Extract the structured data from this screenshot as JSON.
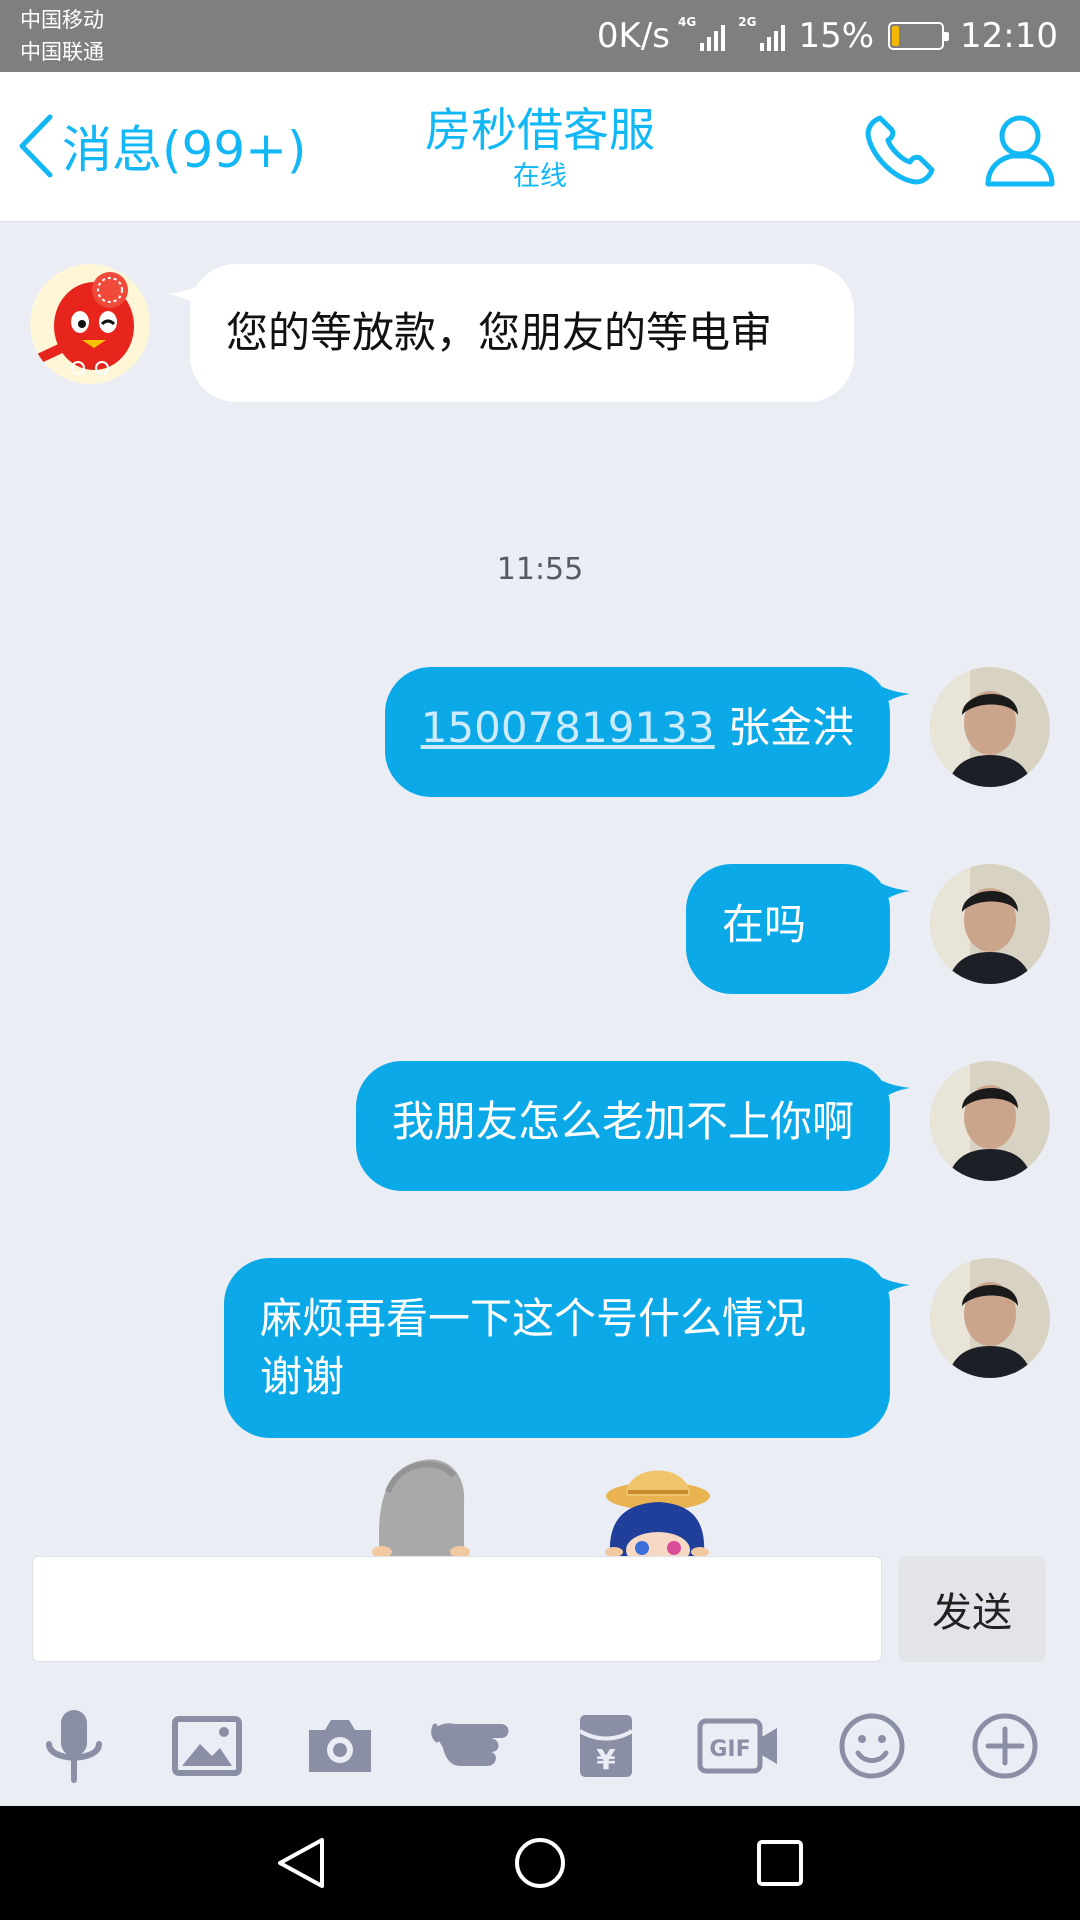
{
  "status_bar": {
    "carrier1": "中国移动",
    "carrier2": "中国联通",
    "net_speed": "0K/s",
    "net_type1": "4G",
    "net_type2": "2G",
    "battery_percent": "15%",
    "battery_level": 0.15,
    "time": "12:10"
  },
  "header": {
    "back_label": "消息(99+)",
    "title": "房秒借客服",
    "subtitle": "在线"
  },
  "chat": {
    "incoming": {
      "text": "您的等放款，您朋友的等电审"
    },
    "time_divider": "11:55",
    "outgoing": [
      {
        "link": "15007819133",
        "text": " 张金洪"
      },
      {
        "text": "在吗"
      },
      {
        "text": "我朋友怎么老加不上你啊"
      },
      {
        "text": "麻烦再看一下这个号什么情况  谢谢"
      }
    ]
  },
  "input": {
    "value": "",
    "send_label": "发送"
  },
  "toolbar": {
    "icons": [
      "microphone-icon",
      "image-icon",
      "camera-icon",
      "poke-icon",
      "red-packet-icon",
      "gif-icon",
      "emoji-icon",
      "plus-icon"
    ]
  },
  "navbar": {
    "icons": [
      "nav-back-icon",
      "nav-home-icon",
      "nav-recents-icon"
    ]
  },
  "colors": {
    "accent": "#12b7f5",
    "outgoing_bubble": "#0ba9e8",
    "chat_bg": "#eaedf4"
  }
}
